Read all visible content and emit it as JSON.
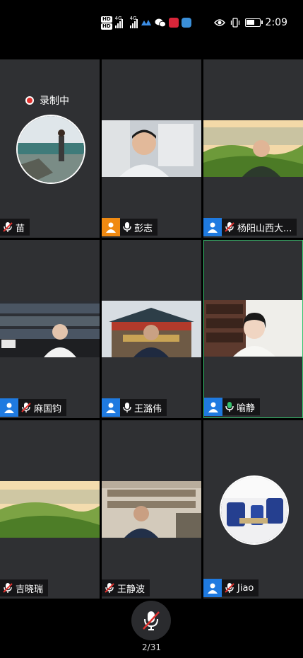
{
  "status_bar": {
    "hd1": "HD",
    "hd2": "HD",
    "net1": "4G",
    "net2": "4G",
    "time": "2:09",
    "battery_level": 0.7
  },
  "recording": {
    "label": "录制中"
  },
  "participants": [
    {
      "name": "苗"
    },
    {
      "name": "彭志"
    },
    {
      "name": "杨阳山西大..."
    },
    {
      "name": "麻国钧"
    },
    {
      "name": "王潞伟"
    },
    {
      "name": "喻静"
    },
    {
      "name": "吉晓瑞"
    },
    {
      "name": "王静波"
    },
    {
      "name": "Jiao"
    }
  ],
  "footer": {
    "page_indicator": "2/31"
  },
  "colors": {
    "accent_green": "#36c26e",
    "avatar_blue": "#1f7ae0",
    "avatar_orange": "#f08a12",
    "rec_red": "#e0322f"
  }
}
